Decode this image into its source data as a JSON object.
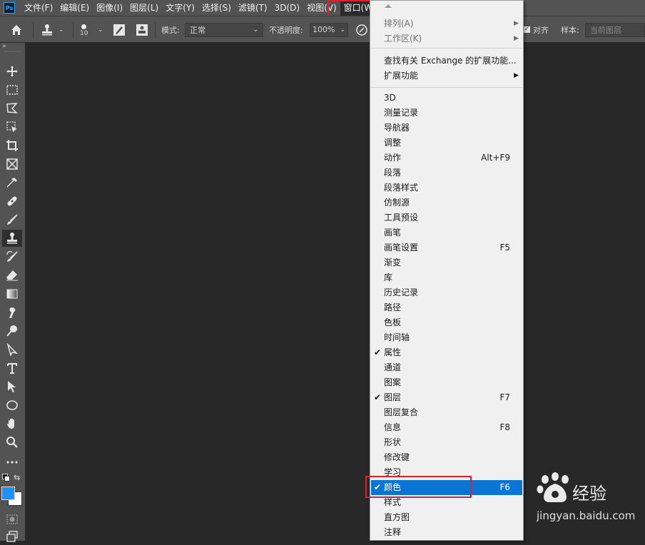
{
  "menubar": {
    "logo": "Ps",
    "items": [
      "文件(F)",
      "编辑(E)",
      "图像(I)",
      "图层(L)",
      "文字(Y)",
      "选择(S)",
      "滤镜(T)",
      "3D(D)",
      "视图(V)",
      "窗口(W)"
    ],
    "active_index": 9
  },
  "options": {
    "brush_size": "10",
    "mode_label": "模式:",
    "mode_value": "正常",
    "opacity_label": "不透明度:",
    "opacity_value": "100%",
    "align_label": "对齐",
    "sample_label": "样本:",
    "sample_value": "当前图层"
  },
  "window_menu": {
    "rows": [
      {
        "label": "排列(A)",
        "submenu": true,
        "checked": false,
        "shortcut": ""
      },
      {
        "label": "工作区(K)",
        "submenu": true,
        "checked": false,
        "shortcut": ""
      },
      {
        "label": "查找有关 Exchange 的扩展功能...",
        "submenu": false,
        "checked": false,
        "shortcut": ""
      },
      {
        "label": "扩展功能",
        "submenu": true,
        "checked": false,
        "shortcut": ""
      },
      {
        "label": "3D",
        "checked": false,
        "shortcut": ""
      },
      {
        "label": "测量记录",
        "checked": false,
        "shortcut": ""
      },
      {
        "label": "导航器",
        "checked": false,
        "shortcut": ""
      },
      {
        "label": "调整",
        "checked": false,
        "shortcut": ""
      },
      {
        "label": "动作",
        "checked": false,
        "shortcut": "Alt+F9"
      },
      {
        "label": "段落",
        "checked": false,
        "shortcut": ""
      },
      {
        "label": "段落样式",
        "checked": false,
        "shortcut": ""
      },
      {
        "label": "仿制源",
        "checked": false,
        "shortcut": ""
      },
      {
        "label": "工具预设",
        "checked": false,
        "shortcut": ""
      },
      {
        "label": "画笔",
        "checked": false,
        "shortcut": ""
      },
      {
        "label": "画笔设置",
        "checked": false,
        "shortcut": "F5"
      },
      {
        "label": "渐变",
        "checked": false,
        "shortcut": ""
      },
      {
        "label": "库",
        "checked": false,
        "shortcut": ""
      },
      {
        "label": "历史记录",
        "checked": false,
        "shortcut": ""
      },
      {
        "label": "路径",
        "checked": false,
        "shortcut": ""
      },
      {
        "label": "色板",
        "checked": false,
        "shortcut": ""
      },
      {
        "label": "时间轴",
        "checked": false,
        "shortcut": ""
      },
      {
        "label": "属性",
        "checked": true,
        "shortcut": ""
      },
      {
        "label": "通道",
        "checked": false,
        "shortcut": ""
      },
      {
        "label": "图案",
        "checked": false,
        "shortcut": ""
      },
      {
        "label": "图层",
        "checked": true,
        "shortcut": "F7"
      },
      {
        "label": "图层复合",
        "checked": false,
        "shortcut": ""
      },
      {
        "label": "信息",
        "checked": false,
        "shortcut": "F8"
      },
      {
        "label": "形状",
        "checked": false,
        "shortcut": ""
      },
      {
        "label": "修改键",
        "checked": false,
        "shortcut": ""
      },
      {
        "label": "学习",
        "checked": false,
        "shortcut": ""
      },
      {
        "label": "颜色",
        "checked": true,
        "shortcut": "F6",
        "selected": true
      },
      {
        "label": "样式",
        "checked": false,
        "shortcut": ""
      },
      {
        "label": "直方图",
        "checked": false,
        "shortcut": ""
      },
      {
        "label": "注释",
        "checked": false,
        "shortcut": ""
      }
    ]
  },
  "watermark": {
    "brand": "Baidu",
    "cn": "经验",
    "url": "jingyan.baidu.com"
  },
  "colors": {
    "highlight": "#e11f2e",
    "selection": "#0b75d3",
    "foreground": "#1e90ff",
    "background": "#ffffff"
  }
}
